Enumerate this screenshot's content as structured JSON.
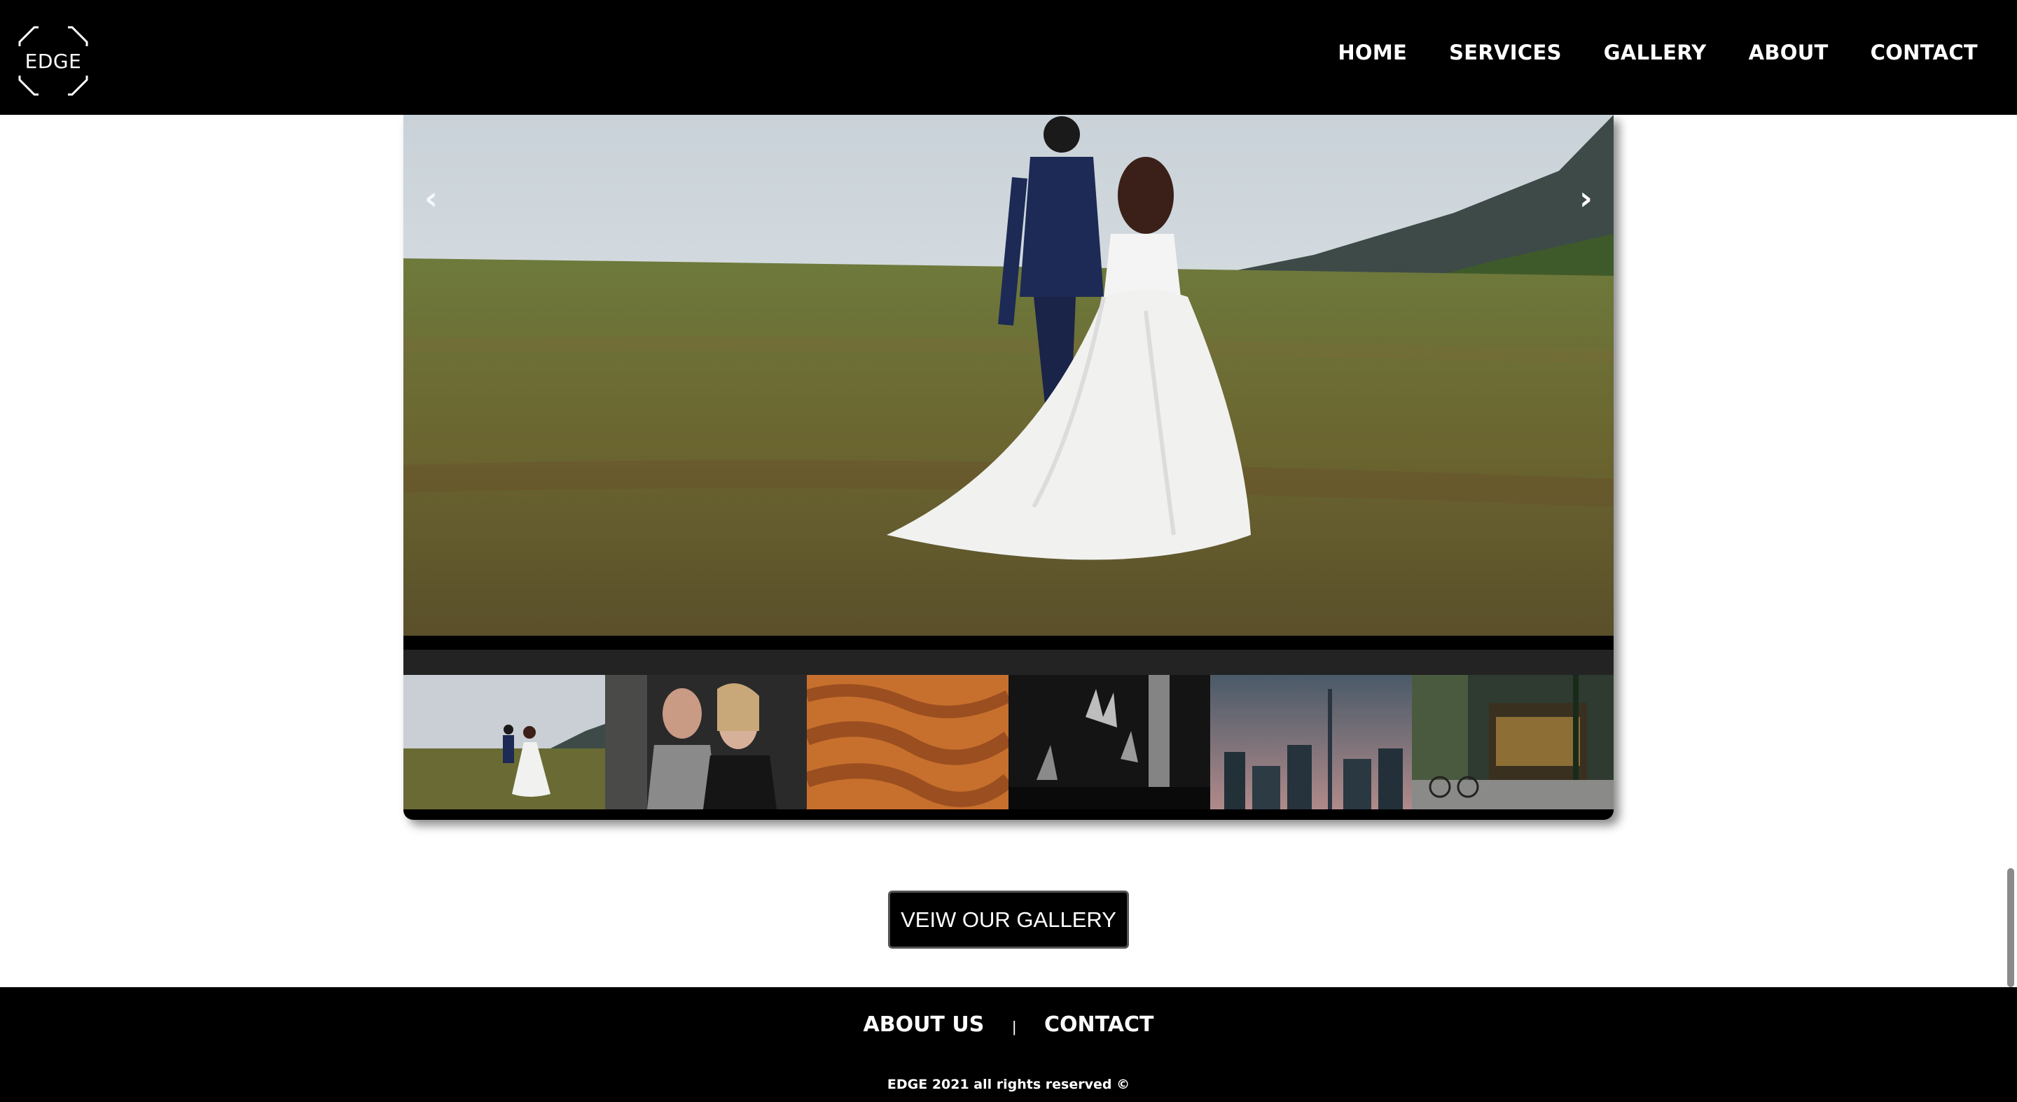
{
  "header": {
    "logo_text": "EDGE",
    "nav": [
      "HOME",
      "SERVICES",
      "GALLERY",
      "ABOUT",
      "CONTACT"
    ]
  },
  "slider": {
    "prev_icon": "‹",
    "next_icon": "›",
    "thumbnails": [
      "wedding-couple",
      "two-women-portrait",
      "desert-dunes",
      "concert-hands",
      "city-skyline",
      "street-shopfront"
    ]
  },
  "cta": {
    "label": "VEIW OUR GALLERY"
  },
  "footer": {
    "links": [
      "ABOUT US",
      "CONTACT"
    ],
    "separator": "|",
    "copyright": "EDGE 2021 all rights reserved ©"
  },
  "colors": {
    "header_bg": "#000000",
    "footer_bg": "#000000",
    "caption_strip": "#232323"
  }
}
